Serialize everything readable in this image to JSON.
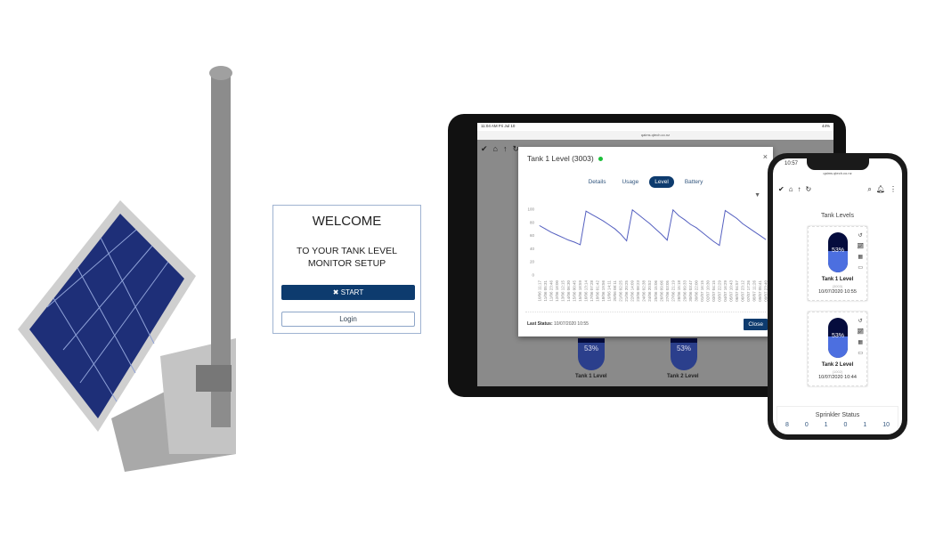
{
  "welcome": {
    "title": "WELCOME",
    "subtitle_line1": "TO YOUR TANK LEVEL",
    "subtitle_line2": "MONITOR SETUP",
    "start_label": "START",
    "start_icon": "tools-icon",
    "login_label": "Login"
  },
  "tablet": {
    "time": "11:04 AM  Fri Jul 10",
    "battery": "44%",
    "url": "qaims.qtech.co.nz",
    "modal": {
      "title": "Tank 1 Level (3003)",
      "status_color": "#1cbf3a",
      "tabs": [
        "Details",
        "Usage",
        "Level",
        "Battery"
      ],
      "active_tab": "Level",
      "last_status_label": "Last Status:",
      "last_status_value": "10/07/2020 10:55",
      "close_label": "Close"
    },
    "background_tanks": [
      {
        "name": "Tank 1 Level",
        "percent": "53%"
      },
      {
        "name": "Tank 2 Level",
        "percent": "53%"
      }
    ]
  },
  "phone": {
    "time": "10:57",
    "url": "qaims.qtech.co.nz",
    "section_title": "Tank Levels",
    "tanks": [
      {
        "name": "Tank 1 Level",
        "id": "(3003)",
        "percent": "53%",
        "level": 53,
        "date": "10/07/2020 10:55"
      },
      {
        "name": "Tank 2 Level",
        "id": "(1002)",
        "percent": "53%",
        "level": 53,
        "date": "10/07/2020 10:44"
      }
    ],
    "sprinkler": {
      "title": "Sprinkler Status",
      "counts": [
        "8",
        "0",
        "1",
        "0",
        "1",
        "10"
      ]
    }
  },
  "colors": {
    "primary": "#0d3b6e",
    "line": "#5560c0",
    "tank_fill": "#4c6fe0",
    "tank_empty": "#050c3d"
  },
  "chart_data": {
    "type": "line",
    "ylim": [
      0,
      100
    ],
    "yticks": [
      0,
      20,
      40,
      60,
      80,
      100
    ],
    "categories": [
      "10/06 11:17",
      "11/06 05:31",
      "11/06 23:46",
      "12/06 18:00",
      "13/06 12:15",
      "14/06 06:30",
      "15/06 00:45",
      "15/06 18:59",
      "16/06 13:14",
      "17/06 07:28",
      "18/06 01:42",
      "18/06 19:56",
      "19/06 14:11",
      "20/06 08:11",
      "21/06 02:25",
      "21/06 20:25",
      "22/06 14:09",
      "23/06 08:23",
      "24/06 02:38",
      "24/06 20:52",
      "25/06 15:06",
      "26/06 09:06",
      "27/06 03:05",
      "27/06 21:19",
      "28/06 15:18",
      "29/06 09:33",
      "30/06 03:47",
      "30/06 22:00",
      "01/07 16:15",
      "02/07 10:30",
      "03/07 04:15",
      "03/07 22:29",
      "04/07 16:29",
      "05/07 10:43",
      "06/07 04:57",
      "06/07 23:12",
      "07/07 17:26",
      "08/07 11:26",
      "09/07 05:41",
      "09/07 23:40"
    ],
    "values": [
      75,
      70,
      65,
      61,
      57,
      53,
      50,
      46,
      97,
      92,
      87,
      82,
      76,
      70,
      62,
      52,
      99,
      92,
      85,
      78,
      70,
      62,
      53,
      99,
      90,
      84,
      77,
      72,
      65,
      58,
      51,
      45,
      98,
      92,
      86,
      78,
      72,
      66,
      60,
      54
    ]
  }
}
